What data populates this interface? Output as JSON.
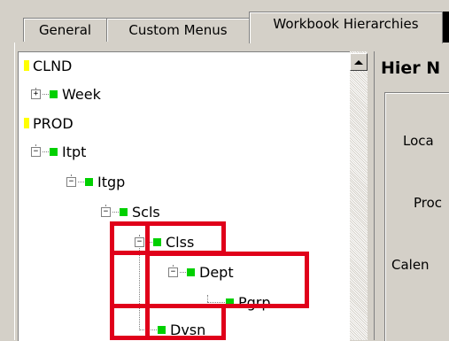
{
  "tabs": [
    {
      "label": "General"
    },
    {
      "label": "Custom Menus"
    },
    {
      "label": "Workbook Hierarchies",
      "active": true
    }
  ],
  "tree": {
    "nodes": [
      {
        "label": "CLND",
        "kind": "root"
      },
      {
        "label": "Week",
        "expander": "+"
      },
      {
        "label": "PROD",
        "kind": "root"
      },
      {
        "label": "Itpt",
        "expander": "−"
      },
      {
        "label": "Itgp",
        "expander": "−"
      },
      {
        "label": "Scls",
        "expander": "−"
      },
      {
        "label": "Clss",
        "expander": "−"
      },
      {
        "label": "Dept",
        "expander": "−"
      },
      {
        "label": "Pgrp"
      },
      {
        "label": "Dvsn"
      }
    ]
  },
  "right_panel": {
    "title": "Hier N",
    "labels": [
      "Loca",
      "Proc",
      "Calen"
    ]
  },
  "colors": {
    "highlight": "#e0001a",
    "dimension_marker": "#ffff00",
    "level_marker": "#00d000"
  },
  "icons": [
    "expand-plus-icon",
    "collapse-minus-icon",
    "scroll-up-arrow-icon"
  ]
}
